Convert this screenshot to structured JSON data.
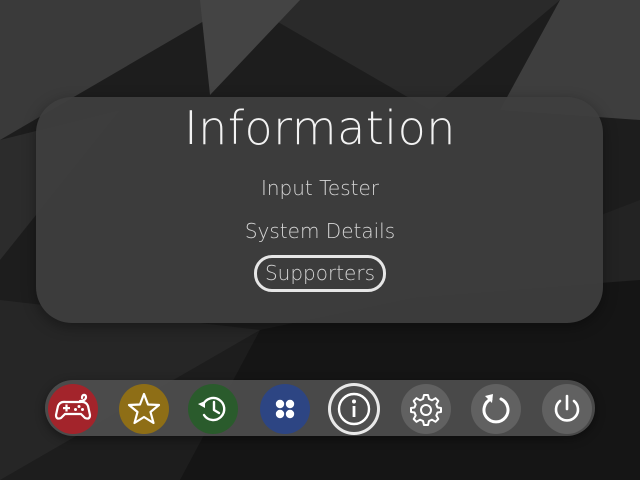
{
  "panel": {
    "title": "Information",
    "items": [
      {
        "label": "Input Tester"
      },
      {
        "label": "System Details"
      },
      {
        "label": "Supporters",
        "selected": true
      }
    ]
  },
  "dock": {
    "buttons": [
      {
        "icon": "gamepad-icon",
        "color": "#a3242b"
      },
      {
        "icon": "star-icon",
        "color": "#8e6e16"
      },
      {
        "icon": "history-icon",
        "color": "#2a5b2c"
      },
      {
        "icon": "apps-grid-icon",
        "color": "#2d4583"
      },
      {
        "icon": "info-icon",
        "color": "#4e4e4e",
        "selected": true
      },
      {
        "icon": "gear-icon",
        "color": "#616161"
      },
      {
        "icon": "restart-icon",
        "color": "#616161"
      },
      {
        "icon": "power-icon",
        "color": "#616161"
      }
    ]
  }
}
